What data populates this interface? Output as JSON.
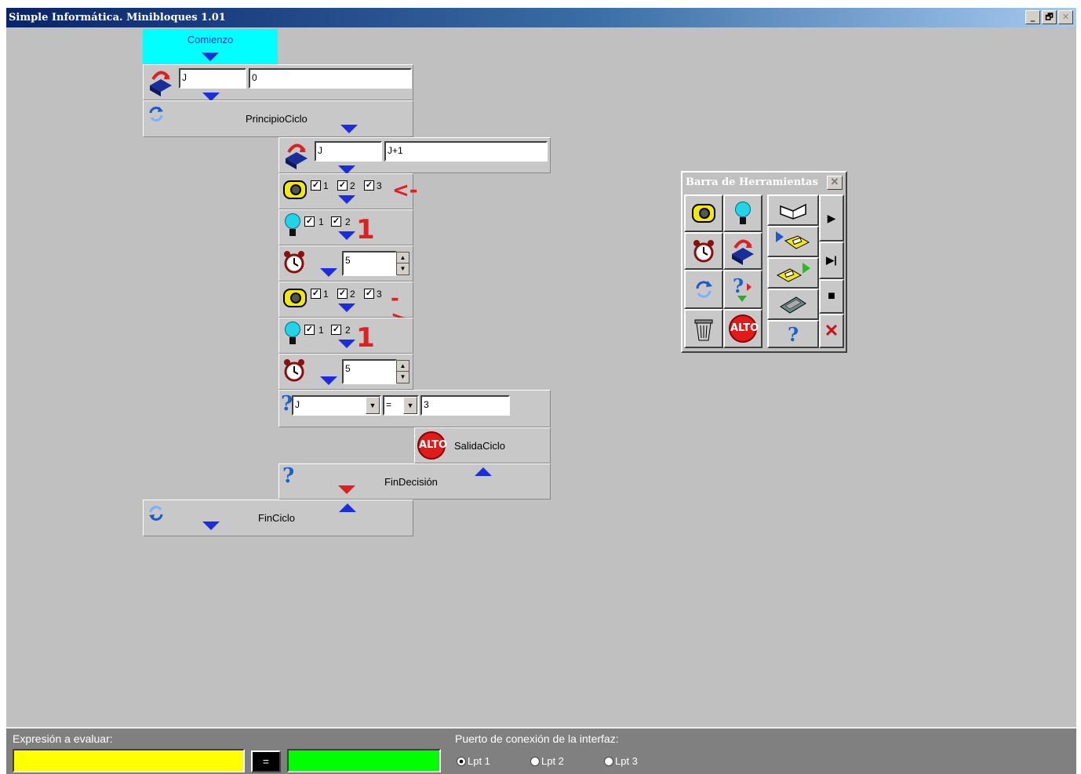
{
  "window": {
    "title": "Simple Informática. Minibloques 1.01",
    "minimize": "_",
    "restore": "🗗",
    "close": "✕"
  },
  "blocks": {
    "start": {
      "label": "Comienzo"
    },
    "assign1": {
      "var": "J",
      "value": "0"
    },
    "loop_start": {
      "label": "PrincipioCiclo"
    },
    "assign2": {
      "var": "J",
      "value": "J+1"
    },
    "motor1": {
      "checks": [
        "1",
        "2",
        "3"
      ],
      "direction": "<-"
    },
    "light1": {
      "checks": [
        "1",
        "2"
      ],
      "state": "1"
    },
    "wait1": {
      "value": "5"
    },
    "motor2": {
      "checks": [
        "1",
        "2",
        "3"
      ],
      "direction": "->"
    },
    "light2": {
      "checks": [
        "1",
        "2"
      ],
      "state": "1"
    },
    "wait2": {
      "value": "5"
    },
    "decision": {
      "left": "J",
      "operator": "=",
      "right": "3"
    },
    "exit_loop": {
      "stop_text": "ALTO",
      "label": "SalidaCiclo"
    },
    "end_decision": {
      "label": "FinDecisión"
    },
    "loop_end": {
      "label": "FinCiclo"
    }
  },
  "palette": {
    "title": "Barra de Herramientas",
    "close": "✕",
    "tools": [
      {
        "name": "motor-tool",
        "icon": "motor-icon"
      },
      {
        "name": "light-tool",
        "icon": "bulb-icon"
      },
      {
        "name": "wait-tool",
        "icon": "clock-icon"
      },
      {
        "name": "assign-tool",
        "icon": "box-arrow-icon"
      },
      {
        "name": "loop-tool",
        "icon": "loop-icon"
      },
      {
        "name": "decision-tool",
        "icon": "question-arrow-icon"
      },
      {
        "name": "delete-tool",
        "icon": "trash-icon"
      },
      {
        "name": "stop-tool",
        "icon": "stop-sign-icon",
        "text": "ALTO"
      },
      {
        "name": "open-tool",
        "icon": "open-book-icon"
      },
      {
        "name": "load-tool",
        "icon": "load-disk-icon"
      },
      {
        "name": "save-tool",
        "icon": "save-disk-icon"
      },
      {
        "name": "calculator-tool",
        "icon": "calculator-icon"
      },
      {
        "name": "help-tool",
        "icon": "help-icon",
        "text": "?"
      },
      {
        "name": "run-button",
        "icon": "play-icon",
        "text": "▶"
      },
      {
        "name": "step-button",
        "icon": "step-icon",
        "text": "▶|"
      },
      {
        "name": "stop-button",
        "icon": "stop-square-icon",
        "text": "■"
      },
      {
        "name": "exit-button",
        "icon": "close-x-icon",
        "text": "✕"
      }
    ]
  },
  "footer": {
    "expression_label": "Expresión a evaluar:",
    "equals": "=",
    "port_label": "Puerto de conexión de la interfaz:",
    "ports": [
      "Lpt 1",
      "Lpt 2",
      "Lpt 3"
    ],
    "selected_port": "Lpt 1",
    "colors": {
      "expression_box": "#ffff00",
      "result_box": "#00ff00"
    }
  }
}
